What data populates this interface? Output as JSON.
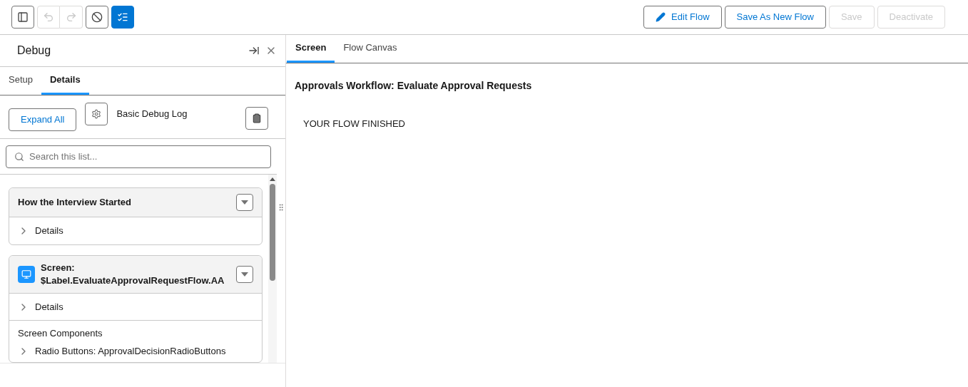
{
  "toolbar": {
    "icon_buttons": [
      {
        "kind": "panel",
        "disabled": false,
        "selected": false
      },
      {
        "kind": "undo",
        "disabled": true,
        "selected": false
      },
      {
        "kind": "redo",
        "disabled": true,
        "selected": false
      },
      {
        "kind": "stop",
        "disabled": false,
        "selected": false
      },
      {
        "kind": "debug",
        "disabled": false,
        "selected": true
      }
    ],
    "actions": [
      {
        "label": "Edit Flow",
        "kind": "edit",
        "disabled": false
      },
      {
        "label": "Save As New Flow",
        "kind": "plain",
        "disabled": false
      },
      {
        "label": "Save",
        "kind": "plain",
        "disabled": true
      },
      {
        "label": "Deactivate",
        "kind": "plain",
        "disabled": true
      }
    ]
  },
  "debug_panel": {
    "title": "Debug",
    "tabs": [
      {
        "label": "Setup",
        "selected": false
      },
      {
        "label": "Details",
        "selected": true
      }
    ],
    "expand_all": "Expand All",
    "log_level": "Basic Debug Log",
    "search": {
      "placeholder": "Search this list..."
    },
    "cards": [
      {
        "kind": "start",
        "title_lines": [
          "How the Interview Started"
        ],
        "rows": [
          {
            "kind": "expander",
            "label": "Details",
            "expanded": false
          }
        ]
      },
      {
        "kind": "screen",
        "title_lines": [
          "Screen:",
          "$Label.EvaluateApprovalRequestFlow.AA"
        ],
        "rows": [
          {
            "kind": "expander",
            "label": "Details",
            "expanded": false
          },
          {
            "kind": "heading",
            "label": "Screen Components"
          },
          {
            "kind": "expander",
            "label": "Radio Buttons: ApprovalDecisionRadioButtons",
            "expanded": false
          }
        ]
      }
    ]
  },
  "main": {
    "tabs": [
      {
        "label": "Screen",
        "selected": true
      },
      {
        "label": "Flow Canvas",
        "selected": false
      }
    ],
    "heading": "Approvals Workflow: Evaluate Approval Requests",
    "message": "YOUR FLOW FINISHED"
  }
}
